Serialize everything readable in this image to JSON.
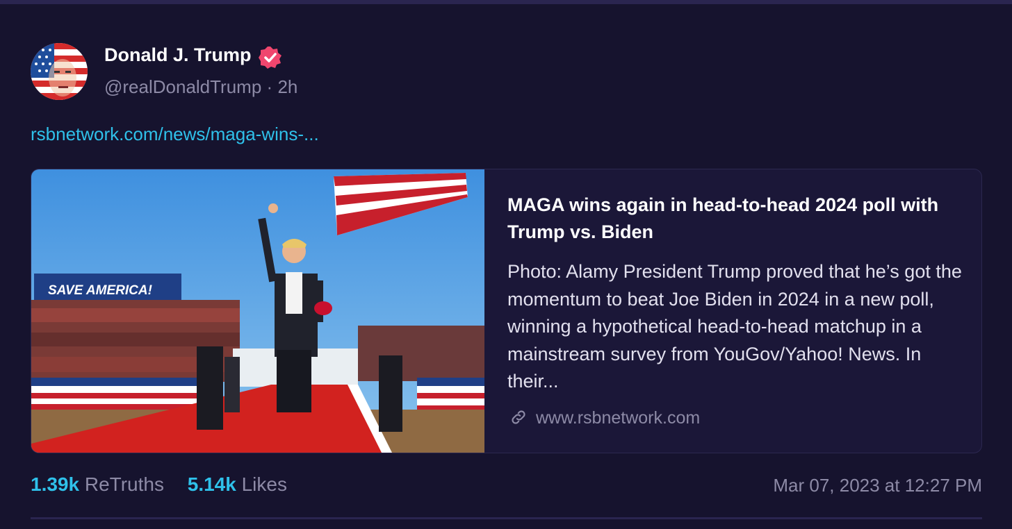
{
  "author": {
    "display_name": "Donald J. Trump",
    "handle": "@realDonaldTrump",
    "separator": "·",
    "time_ago": "2h",
    "verified_color": "#f0466e"
  },
  "post": {
    "link_text": "rsbnetwork.com/news/maga-wins-..."
  },
  "card": {
    "image_caption": "SAVE AMERICA!",
    "title": "MAGA wins again in head-to-head 2024 poll with Trump vs. Biden",
    "description": "Photo: Alamy President Trump proved that he’s got the momentum to beat Joe Biden in 2024 in a new poll, winning a hypothetical head-to-head matchup in a mainstream survey from YouGov/Yahoo! News. In their...",
    "domain": "www.rsbnetwork.com"
  },
  "stats": {
    "retruths_count": "1.39k",
    "retruths_label": "ReTruths",
    "likes_count": "5.14k",
    "likes_label": "Likes"
  },
  "timestamp": "Mar 07, 2023 at 12:27 PM",
  "colors": {
    "background": "#16132e",
    "accent_link": "#2fc1ea",
    "muted_text": "#8d8aa6",
    "card_background": "#1b1738"
  }
}
